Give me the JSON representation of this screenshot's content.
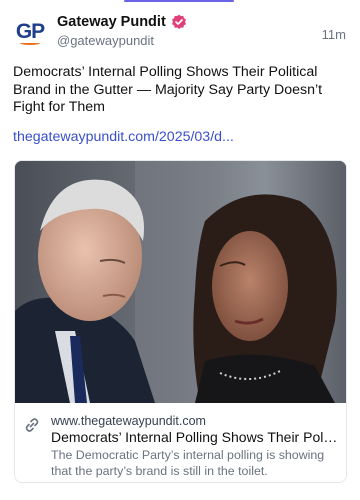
{
  "author": {
    "display_name": "Gateway Pundit",
    "handle": "@gatewaypundit",
    "avatar_text": "GP",
    "verified_color": "#e0407a"
  },
  "post": {
    "timestamp": "11m",
    "text": "Democrats’ Internal Polling Shows Their Political Brand in the Gutter — Majority Say Party Doesn’t Fight for Them",
    "link_text": "thegatewaypundit.com/2025/03/d..."
  },
  "link_card": {
    "domain": "www.thegatewaypundit.com",
    "title": "Democrats’ Internal Polling Shows Their Politic...",
    "description": "The Democratic Party’s internal polling is showing that the party’s brand is still in the toilet.",
    "icon": "link-icon"
  },
  "colors": {
    "accent": "#6b63e6",
    "link": "#3a50c8",
    "avatar_blue": "#1f3e8c",
    "avatar_orange": "#e8701a"
  }
}
